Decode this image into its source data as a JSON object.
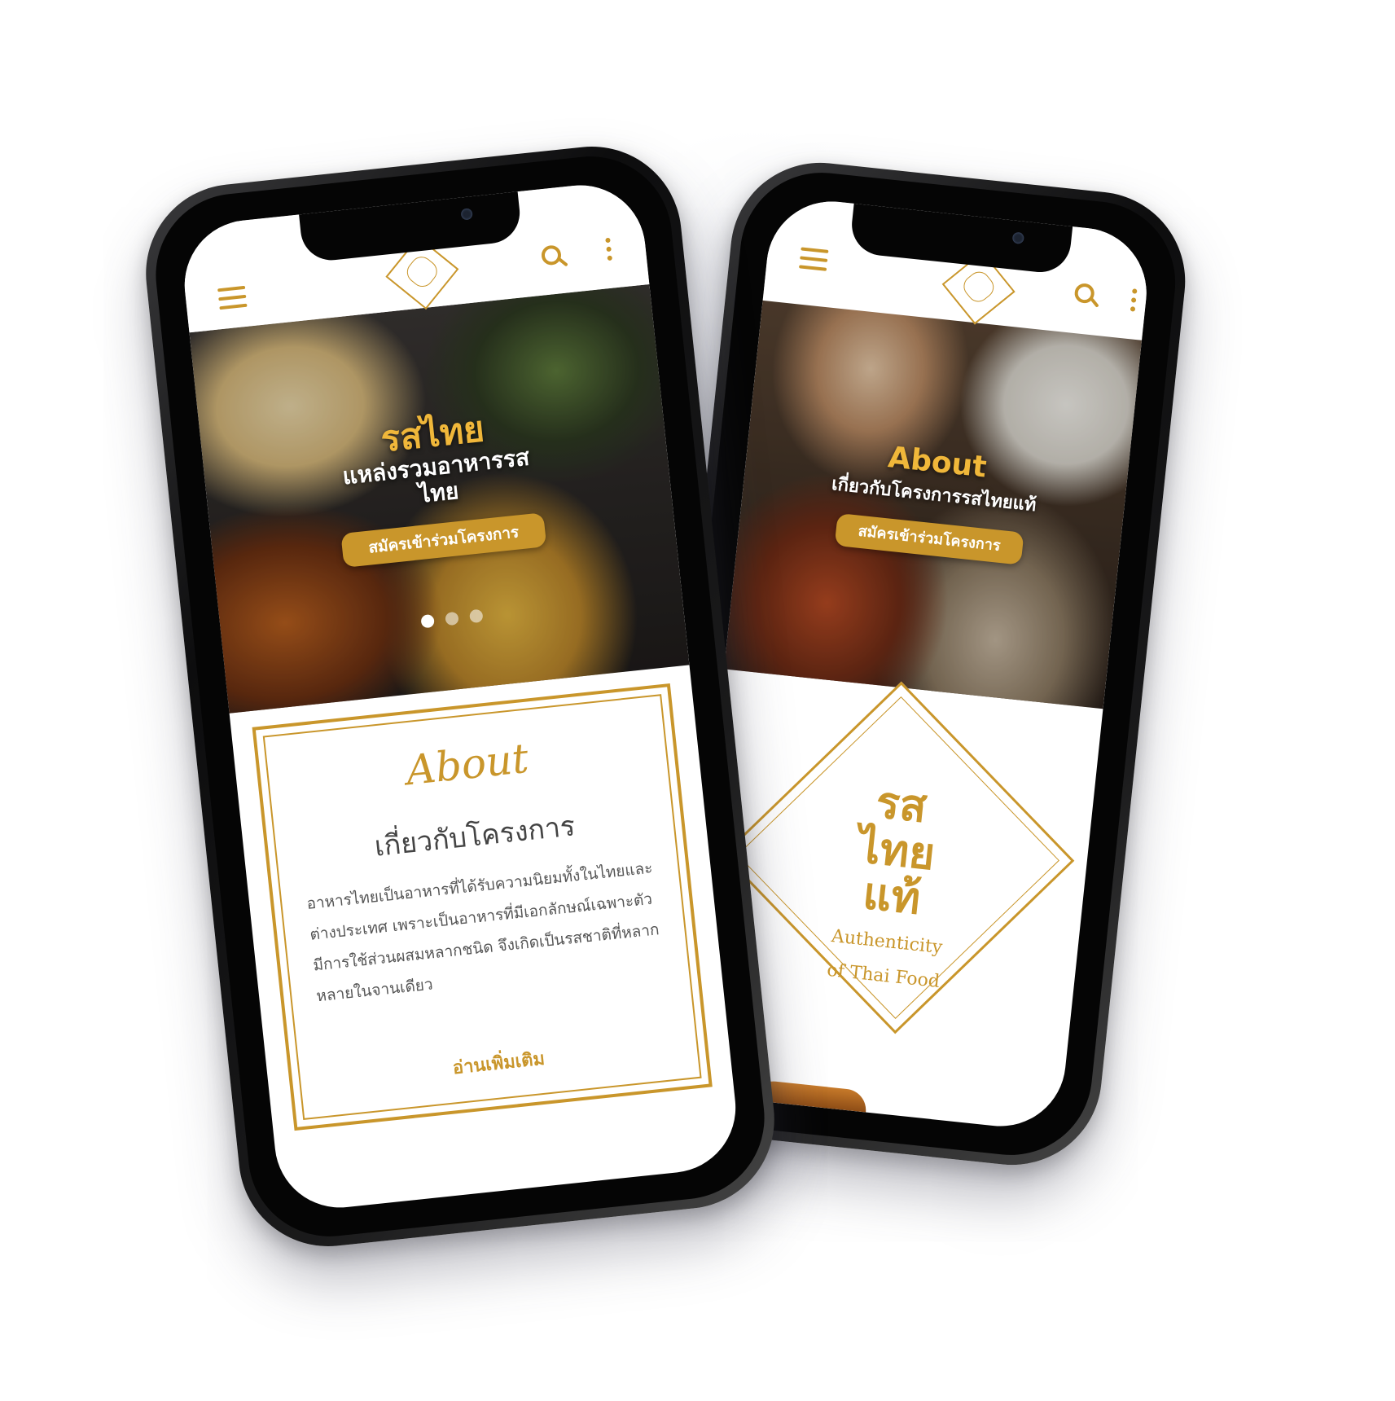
{
  "screen_a": {
    "hero_title": "รสไทย",
    "hero_subtitle": "แหล่งรวมอาหารรส ไทย",
    "cta_label": "สมัครเข้าร่วมโครงการ",
    "about_script": "About",
    "about_heading": "เกี่ยวกับโครงการ",
    "about_body": "อาหารไทยเป็นอาหารที่ได้รับความนิยมทั้งในไทยและต่างประเทศ เพราะเป็นอาหารที่มีเอกลักษณ์เฉพาะตัว มีการใช้ส่วนผสมหลากชนิด จึงเกิดเป็นรสชาติที่หลากหลายในจานเดียว",
    "read_more": "อ่านเพิ่มเติม"
  },
  "screen_b": {
    "hero_title": "About",
    "hero_subtitle": "เกี่ยวกับโครงการรสไทยแท้",
    "cta_label": "สมัครเข้าร่วมโครงการ",
    "logo_thai": [
      "รส",
      "ไทย",
      "แท้"
    ],
    "logo_english_line1": "Authenticity",
    "logo_english_line2": "of Thai Food"
  },
  "colors": {
    "accent": "#c9962b",
    "accent_bright": "#f0b73a"
  },
  "icons": [
    "menu-icon",
    "search-icon",
    "more-vert-icon",
    "logo-icon"
  ]
}
